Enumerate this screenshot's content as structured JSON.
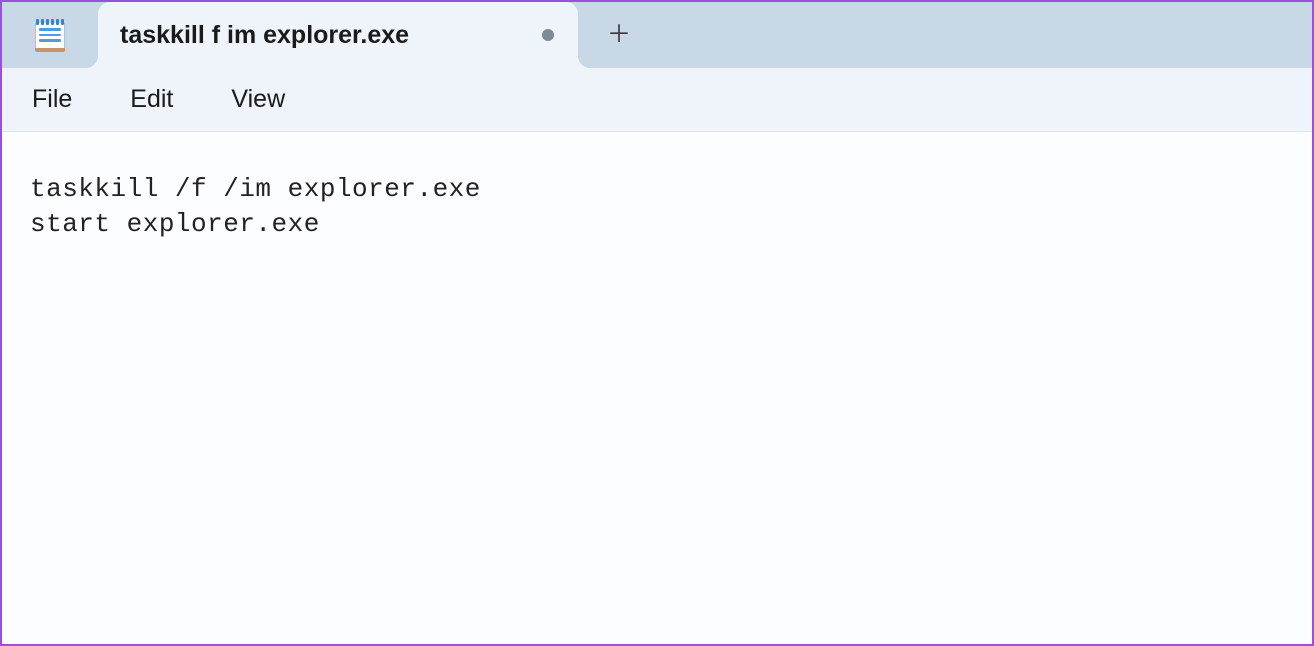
{
  "tabs": [
    {
      "title": "taskkill f im explorer.exe",
      "modified": true
    }
  ],
  "menu": {
    "file": "File",
    "edit": "Edit",
    "view": "View"
  },
  "editor": {
    "content": "taskkill /f /im explorer.exe\nstart explorer.exe"
  }
}
